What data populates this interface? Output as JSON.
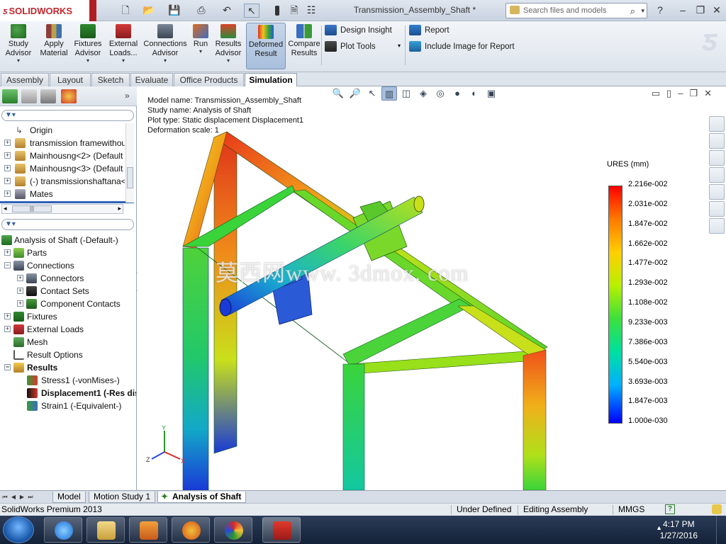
{
  "app": {
    "brand": "SOLIDWORKS",
    "document_title": "Transmission_Assembly_Shaft *",
    "search_placeholder": "Search files and models"
  },
  "command_manager": {
    "buttons": [
      {
        "label": "Study Advisor",
        "icon": "study-advisor-icon"
      },
      {
        "label": "Apply Material",
        "icon": "apply-material-icon"
      },
      {
        "label": "Fixtures Advisor",
        "icon": "fixtures-icon"
      },
      {
        "label": "External Loads...",
        "icon": "external-loads-icon"
      },
      {
        "label": "Connections Advisor",
        "icon": "connections-icon"
      },
      {
        "label": "Run",
        "icon": "run-icon"
      },
      {
        "label": "Results Advisor",
        "icon": "results-advisor-icon"
      },
      {
        "label": "Deformed Result",
        "icon": "deformed-result-icon"
      },
      {
        "label": "Compare Results",
        "icon": "compare-results-icon"
      }
    ],
    "small_buttons": [
      "Design Insight",
      "Plot Tools",
      "Report",
      "Include Image for Report"
    ]
  },
  "tabs": [
    "Assembly",
    "Layout",
    "Sketch",
    "Evaluate",
    "Office Products",
    "Simulation"
  ],
  "active_tab": "Simulation",
  "feature_tree": [
    {
      "label": "Origin",
      "icon": "origin-icon"
    },
    {
      "label": "transmission framewithou",
      "icon": "part-icon"
    },
    {
      "label": "Mainhousng<2> (Default",
      "icon": "part-icon"
    },
    {
      "label": "Mainhousng<3> (Default",
      "icon": "part-icon"
    },
    {
      "label": "(-) transmissionshaftana<",
      "icon": "part-icon"
    },
    {
      "label": "Mates",
      "icon": "mates-icon"
    }
  ],
  "study_tree": [
    {
      "label": "Analysis of Shaft (-Default-)",
      "level": 0
    },
    {
      "label": "Parts",
      "level": 1
    },
    {
      "label": "Connections",
      "level": 1
    },
    {
      "label": "Connectors",
      "level": 2
    },
    {
      "label": "Contact Sets",
      "level": 2
    },
    {
      "label": "Component Contacts",
      "level": 2
    },
    {
      "label": "Fixtures",
      "level": 1
    },
    {
      "label": "External Loads",
      "level": 1
    },
    {
      "label": "Mesh",
      "level": 1
    },
    {
      "label": "Result Options",
      "level": 1
    },
    {
      "label": "Results",
      "level": 1
    },
    {
      "label": "Stress1 (-vonMises-)",
      "level": 2
    },
    {
      "label": "Displacement1 (-Res dis",
      "level": 2
    },
    {
      "label": "Strain1 (-Equivalent-)",
      "level": 2
    }
  ],
  "plot_info": {
    "model_name": "Model name: Transmission_Assembly_Shaft",
    "study_name": "Study name: Analysis of Shaft",
    "plot_type": "Plot type: Static displacement Displacement1",
    "deformation_scale": "Deformation scale: 1"
  },
  "legend": {
    "title": "URES (mm)",
    "values": [
      "2.216e-002",
      "2.031e-002",
      "1.847e-002",
      "1.662e-002",
      "1.477e-002",
      "1.293e-002",
      "1.108e-002",
      "9.233e-003",
      "7.386e-003",
      "5.540e-003",
      "3.693e-003",
      "1.847e-003",
      "1.000e-030"
    ]
  },
  "watermark": "莫西网www. 3dmox. com",
  "bottom_tabs": [
    "Model",
    "Motion Study 1",
    "Analysis of Shaft"
  ],
  "active_bottom_tab": "Analysis of Shaft",
  "status_bar": {
    "product": "SolidWorks Premium 2013",
    "state": "Under Defined",
    "mode": "Editing Assembly",
    "units": "MMGS"
  },
  "taskbar": {
    "time": "4:17 PM",
    "date": "1/27/2016",
    "apps": [
      "internet-explorer-icon",
      "file-explorer-icon",
      "media-player-icon",
      "firefox-icon",
      "paint-icon",
      "solidworks-icon"
    ]
  },
  "triad_labels": {
    "y": "Y",
    "z": "Z",
    "x": "X"
  }
}
